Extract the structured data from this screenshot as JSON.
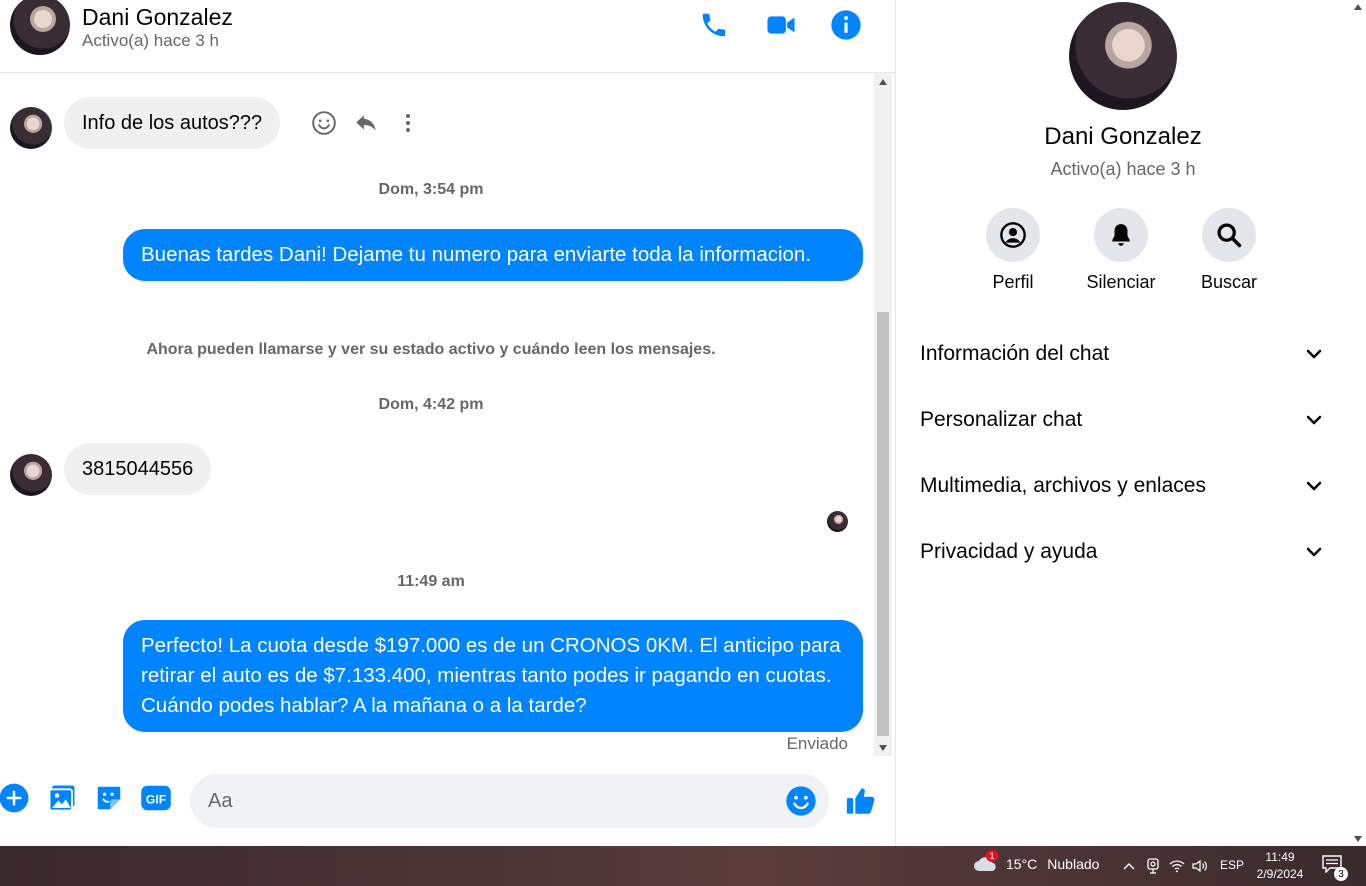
{
  "header": {
    "name": "Dani Gonzalez",
    "status": "Activo(a) hace 3 h",
    "icons": [
      "phone-icon",
      "video-camera-icon",
      "info-icon"
    ]
  },
  "messages": {
    "m1_text": "Info de los autos???",
    "ts1": "Dom, 3:54 pm",
    "m2_text": "Buenas tardes Dani! Dejame tu numero para enviarte toda la informacion.",
    "notice": "Ahora pueden llamarse y ver su estado activo y cuándo leen los mensajes.",
    "ts2": "Dom, 4:42 pm",
    "m3_text": "3815044556",
    "ts3": "11:49 am",
    "m4_text": "Perfecto! La cuota desde $197.000 es de un CRONOS 0KM. El anticipo para retirar el auto es de $7.133.400, mientras tanto podes ir pagando en cuotas. Cuándo podes hablar? A la mañana o a la tarde?",
    "sent_label": "Enviado"
  },
  "composer": {
    "placeholder": "Aa",
    "icons": [
      "plus-icon",
      "image-icon",
      "sticker-icon",
      "gif-icon",
      "emoji-icon",
      "thumbs-up-icon"
    ],
    "gif_label": "GIF"
  },
  "panel": {
    "name": "Dani Gonzalez",
    "status": "Activo(a) hace 3 h",
    "actions": [
      {
        "label": "Perfil",
        "icon": "profile-icon"
      },
      {
        "label": "Silenciar",
        "icon": "bell-icon"
      },
      {
        "label": "Buscar",
        "icon": "search-icon"
      }
    ],
    "sections": [
      {
        "label": "Información del chat"
      },
      {
        "label": "Personalizar chat"
      },
      {
        "label": "Multimedia, archivos y enlaces"
      },
      {
        "label": "Privacidad y ayuda"
      }
    ]
  },
  "taskbar": {
    "temperature": "15°C",
    "weather": "Nublado",
    "weather_badge": "1",
    "lang": "ESP",
    "time": "11:49",
    "date": "2/9/2024",
    "notification_count": "3"
  },
  "colors": {
    "accent": "#0084ff",
    "incoming_bubble": "#f0f0f0",
    "secondary_text": "#65676b"
  }
}
